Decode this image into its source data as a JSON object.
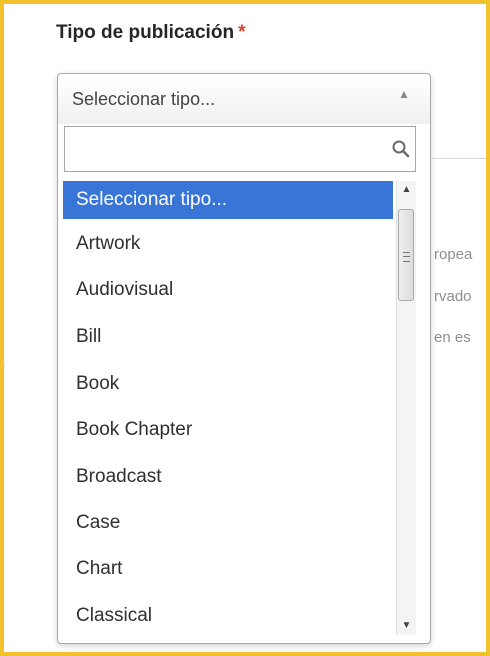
{
  "field": {
    "label": "Tipo de publicación",
    "required_mark": "*"
  },
  "select": {
    "current_value": "Seleccionar tipo...",
    "search_value": "",
    "options": [
      {
        "label": "Seleccionar tipo...",
        "highlighted": true
      },
      {
        "label": "Artwork",
        "highlighted": false
      },
      {
        "label": "Audiovisual",
        "highlighted": false
      },
      {
        "label": "Bill",
        "highlighted": false
      },
      {
        "label": "Book",
        "highlighted": false
      },
      {
        "label": "Book Chapter",
        "highlighted": false
      },
      {
        "label": "Broadcast",
        "highlighted": false
      },
      {
        "label": "Case",
        "highlighted": false
      },
      {
        "label": "Chart",
        "highlighted": false
      },
      {
        "label": "Classical",
        "highlighted": false
      }
    ]
  },
  "background_fragments": [
    "ropea",
    "rvado",
    "en es"
  ],
  "colors": {
    "frame": "#f2c12e",
    "highlight": "#3875d7",
    "required": "#e0442a"
  },
  "icons": {
    "search": "search-icon",
    "open_arrow": "triangle-up-icon",
    "scroll_up": "scroll-up-arrow-icon",
    "scroll_down": "scroll-down-arrow-icon"
  }
}
